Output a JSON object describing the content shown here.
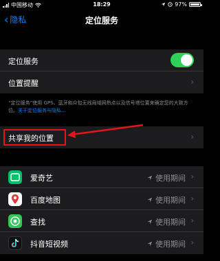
{
  "status_bar": {
    "carrier": "中国移动",
    "time": "18:29",
    "battery": "97%",
    "battery_level": 0.97
  },
  "nav": {
    "back_label": "隐私",
    "title": "定位服务"
  },
  "location_group": {
    "location_services_label": "定位服务",
    "location_services_on": true,
    "location_alerts_label": "位置提醒"
  },
  "footnote": {
    "text": "“定位服务”使用 GPS、蓝牙和众包无线局域网热点以及信号塔位置来确定您的大致方位。",
    "link": "关于定位服务与隐私…"
  },
  "share_group": {
    "share_location_label": "共享我的位置"
  },
  "apps": [
    {
      "name": "爱奇艺",
      "status": "使用期间",
      "icon": "iqiyi-icon"
    },
    {
      "name": "百度地图",
      "status": "使用期间",
      "icon": "baidu-map-icon"
    },
    {
      "name": "查找",
      "status": "使用期间",
      "icon": "find-my-icon"
    },
    {
      "name": "抖音短视频",
      "status": "使用期间",
      "icon": "douyin-icon"
    }
  ],
  "colors": {
    "accent": "#0a84ff",
    "toggle_on": "#30d158",
    "annotation": "#e8141b"
  }
}
